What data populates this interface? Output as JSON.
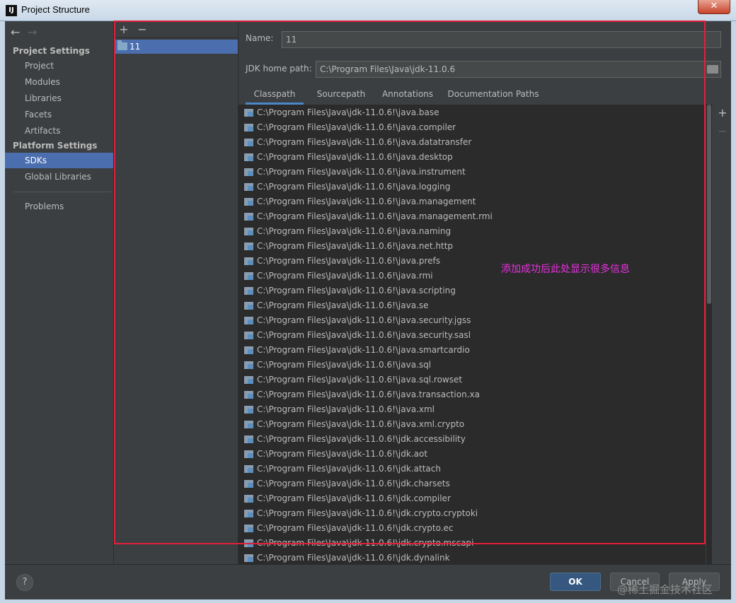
{
  "window": {
    "title": "Project Structure",
    "app_icon": "IJ",
    "close_icon": "✕"
  },
  "nav": {
    "back": "←",
    "forward": "→"
  },
  "sidebar": {
    "project_settings_title": "Project Settings",
    "project_items": [
      "Project",
      "Modules",
      "Libraries",
      "Facets",
      "Artifacts"
    ],
    "platform_settings_title": "Platform Settings",
    "platform_items": [
      "SDKs",
      "Global Libraries"
    ],
    "selected": "SDKs",
    "problems": "Problems"
  },
  "sdk_list": {
    "add": "+",
    "remove": "−",
    "items": [
      "11"
    ]
  },
  "detail": {
    "name_label": "Name:",
    "name_value": "11",
    "jdk_home_label": "JDK home path:",
    "jdk_home_value": "C:\\Program Files\\Java\\jdk-11.0.6",
    "tabs": [
      "Classpath",
      "Sourcepath",
      "Annotations",
      "Documentation Paths"
    ],
    "active_tab": "Classpath",
    "side_add": "+",
    "side_remove": "−",
    "classpath": [
      "C:\\Program Files\\Java\\jdk-11.0.6!\\java.base",
      "C:\\Program Files\\Java\\jdk-11.0.6!\\java.compiler",
      "C:\\Program Files\\Java\\jdk-11.0.6!\\java.datatransfer",
      "C:\\Program Files\\Java\\jdk-11.0.6!\\java.desktop",
      "C:\\Program Files\\Java\\jdk-11.0.6!\\java.instrument",
      "C:\\Program Files\\Java\\jdk-11.0.6!\\java.logging",
      "C:\\Program Files\\Java\\jdk-11.0.6!\\java.management",
      "C:\\Program Files\\Java\\jdk-11.0.6!\\java.management.rmi",
      "C:\\Program Files\\Java\\jdk-11.0.6!\\java.naming",
      "C:\\Program Files\\Java\\jdk-11.0.6!\\java.net.http",
      "C:\\Program Files\\Java\\jdk-11.0.6!\\java.prefs",
      "C:\\Program Files\\Java\\jdk-11.0.6!\\java.rmi",
      "C:\\Program Files\\Java\\jdk-11.0.6!\\java.scripting",
      "C:\\Program Files\\Java\\jdk-11.0.6!\\java.se",
      "C:\\Program Files\\Java\\jdk-11.0.6!\\java.security.jgss",
      "C:\\Program Files\\Java\\jdk-11.0.6!\\java.security.sasl",
      "C:\\Program Files\\Java\\jdk-11.0.6!\\java.smartcardio",
      "C:\\Program Files\\Java\\jdk-11.0.6!\\java.sql",
      "C:\\Program Files\\Java\\jdk-11.0.6!\\java.sql.rowset",
      "C:\\Program Files\\Java\\jdk-11.0.6!\\java.transaction.xa",
      "C:\\Program Files\\Java\\jdk-11.0.6!\\java.xml",
      "C:\\Program Files\\Java\\jdk-11.0.6!\\java.xml.crypto",
      "C:\\Program Files\\Java\\jdk-11.0.6!\\jdk.accessibility",
      "C:\\Program Files\\Java\\jdk-11.0.6!\\jdk.aot",
      "C:\\Program Files\\Java\\jdk-11.0.6!\\jdk.attach",
      "C:\\Program Files\\Java\\jdk-11.0.6!\\jdk.charsets",
      "C:\\Program Files\\Java\\jdk-11.0.6!\\jdk.compiler",
      "C:\\Program Files\\Java\\jdk-11.0.6!\\jdk.crypto.cryptoki",
      "C:\\Program Files\\Java\\jdk-11.0.6!\\jdk.crypto.ec",
      "C:\\Program Files\\Java\\jdk-11.0.6!\\jdk.crypto.mscapi",
      "C:\\Program Files\\Java\\jdk-11.0.6!\\jdk.dynalink"
    ]
  },
  "annotation": "添加成功后此处显示很多信息",
  "footer": {
    "help": "?",
    "ok": "OK",
    "cancel": "Cancel",
    "apply": "Apply"
  },
  "watermark": "@稀土掘金技术社区",
  "colors": {
    "selection": "#4b6eaf",
    "highlight_box": "#e0203a",
    "annotation": "#e830e0"
  }
}
